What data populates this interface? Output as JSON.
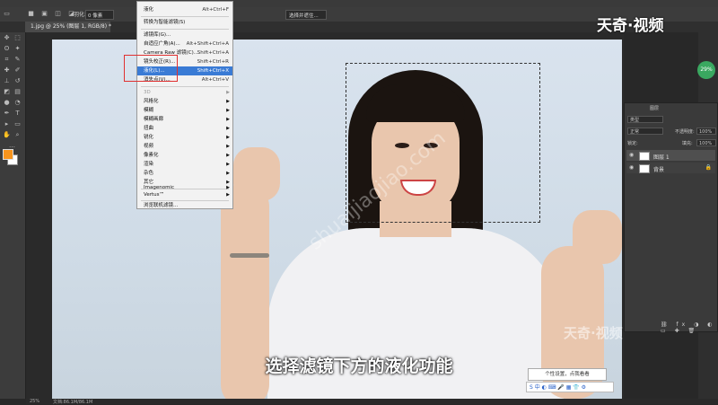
{
  "app": {
    "doc_tab": "1.jpg @ 25% (图层 1, RGB/8) *",
    "brand_logo": "天奇·视频",
    "watermark_logo": "天奇·视频",
    "watermark_url": "shuaijiaojiao.com"
  },
  "options_bar": {
    "feather_label": "羽化:",
    "feather_value": "0 像素",
    "select_mask_button": "选择并遮住..."
  },
  "filter_menu": {
    "items": [
      {
        "label": "液化",
        "shortcut": "Alt+Ctrl+F"
      },
      {
        "label": "转换为智能滤镜(S)",
        "shortcut": ""
      },
      {
        "label": "滤镜库(G)...",
        "shortcut": ""
      },
      {
        "label": "自适应广角(A)...",
        "shortcut": "Alt+Shift+Ctrl+A"
      },
      {
        "label": "Camera Raw 滤镜(C)...",
        "shortcut": "Shift+Ctrl+A"
      },
      {
        "label": "镜头校正(R)...",
        "shortcut": "Shift+Ctrl+R"
      },
      {
        "label": "液化(L)...",
        "shortcut": "Shift+Ctrl+X"
      },
      {
        "label": "消失点(V)...",
        "shortcut": "Alt+Ctrl+V"
      },
      {
        "label": "3D",
        "shortcut": ""
      },
      {
        "label": "风格化",
        "shortcut": ""
      },
      {
        "label": "模糊",
        "shortcut": ""
      },
      {
        "label": "模糊画廊",
        "shortcut": ""
      },
      {
        "label": "扭曲",
        "shortcut": ""
      },
      {
        "label": "锐化",
        "shortcut": ""
      },
      {
        "label": "视频",
        "shortcut": ""
      },
      {
        "label": "像素化",
        "shortcut": ""
      },
      {
        "label": "渲染",
        "shortcut": ""
      },
      {
        "label": "杂色",
        "shortcut": ""
      },
      {
        "label": "其它",
        "shortcut": ""
      },
      {
        "label": "Imagenomic",
        "shortcut": ""
      },
      {
        "label": "Vertus™",
        "shortcut": ""
      },
      {
        "label": "浏览联机滤镜...",
        "shortcut": ""
      }
    ]
  },
  "layers_panel": {
    "tab_layers": "图层",
    "filter_kind": "类型",
    "blend_mode": "正常",
    "opacity_label": "不透明度:",
    "opacity_value": "100%",
    "lock_label": "锁定:",
    "fill_label": "填充:",
    "fill_value": "100%",
    "layers": [
      {
        "name": "图层 1",
        "selected": true
      },
      {
        "name": "背景",
        "selected": false
      }
    ]
  },
  "right_strip": {
    "percent_badge": "29%"
  },
  "status_bar": {
    "zoom": "25%",
    "doc_info": "文档:86.1M/86.1M"
  },
  "subtitle": "选择滤镜下方的液化功能",
  "tooltip": "个性设置，点我看看",
  "ime_bar": "S 中 ◐ ⌨ 🎤 ▦ 👕 ⚙",
  "colors": {
    "foreground": "#f7941d",
    "background": "#ffffff",
    "menu_highlight": "#3a7bd5"
  }
}
